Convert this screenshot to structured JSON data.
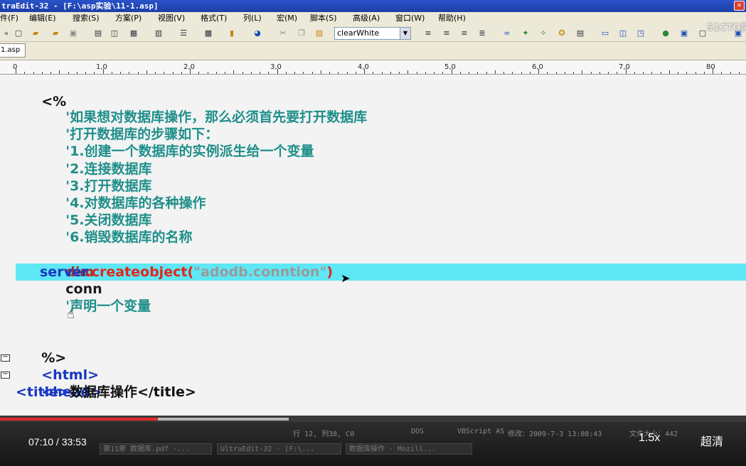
{
  "window": {
    "title": "traEdit-32 - [F:\\asp实验\\11-1.asp]",
    "close_glyph": "✕"
  },
  "menu": [
    {
      "label": "件(F)"
    },
    {
      "label": "编辑(E)"
    },
    {
      "label": "搜索(S)"
    },
    {
      "label": "方案(P)"
    },
    {
      "label": "视图(V)"
    },
    {
      "label": "格式(T)"
    },
    {
      "label": "列(L)"
    },
    {
      "label": "宏(M)"
    },
    {
      "label": "脚本(S)"
    },
    {
      "label": "高级(A)"
    },
    {
      "label": "窗口(W)"
    },
    {
      "label": "帮助(H)"
    }
  ],
  "toolbar": {
    "theme_value": "clearWhite",
    "watermark": "51CTO学",
    "icons": [
      "new-file-icon",
      "open-folder-icon",
      "folder-icon",
      "save-icon",
      "print-icon",
      "print-preview-icon",
      "find-icon",
      "copy-file-icon",
      "wrap-icon",
      "hex-icon",
      "column-icon",
      "browser-icon",
      "cut-icon",
      "copy-icon",
      "paste-icon",
      "align-left-icon",
      "align-center-icon",
      "align-right-icon",
      "justify-icon",
      "binoculars-icon",
      "find-next-icon",
      "replace-icon",
      "goto-icon",
      "print2-icon",
      "window-icon",
      "split-icon",
      "tile-icon",
      "web-icon",
      "display-icon",
      "tool-icon"
    ]
  },
  "tab": {
    "label": "1.asp"
  },
  "ruler": {
    "labels": [
      "0",
      "1,0",
      "2,0",
      "3,0",
      "4,0",
      "5,0",
      "6,0",
      "7,0",
      "80"
    ]
  },
  "editor": {
    "l1": "<%",
    "c1": "'如果想对数据库操作，那么必须首先要打开数据库",
    "c2": "'打开数据库的步骤如下：",
    "c3": "'1.创建一个数据库的实例派生给一个变量",
    "c4": "'2.连接数据库",
    "c5": "'3.打开数据库",
    "c6": "'4.对数据库的各种操作",
    "c7": "'5.关闭数据库",
    "c8": "'6.销毁数据库的名称",
    "dim_kw": "dim",
    "dim_var": "conn",
    "dim_comment": "'声明一个变量",
    "srv_obj": "server",
    "srv_dot": ".",
    "srv_method": "createobject",
    "srv_open": "(",
    "srv_str": "\"adodb.conntion\"",
    "srv_close": ")",
    "end_delim": "%>",
    "html_tag": "<html>",
    "head_tag": "<head>",
    "title_open": "<title>",
    "title_text": "数据库操作",
    "title_close": "</title>"
  },
  "status": {
    "pos": "行 12, 列38, C0",
    "enc": "DOS",
    "lang": "VBScript AS",
    "modified": "修改：2009-7-3 13:08:43",
    "size": "文件大小：442"
  },
  "player": {
    "time": "07:10 / 33:53",
    "speed": "1.5x",
    "quality": "超清",
    "played_fraction": 0.2115,
    "buffered_fraction": 0.176
  },
  "taskbar": [
    {
      "label": "第11章 数据库.pdf -..."
    },
    {
      "label": "UltraEdit-32 - [F:\\..."
    },
    {
      "label": "数据库操作 - Mozill..."
    }
  ]
}
